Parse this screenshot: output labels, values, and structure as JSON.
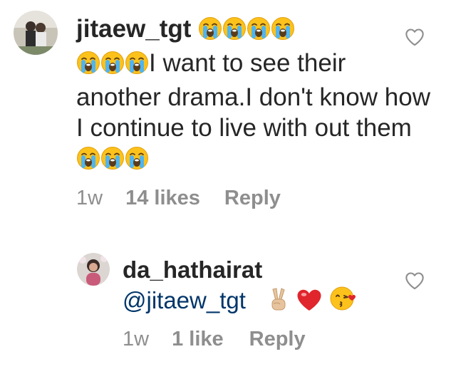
{
  "comments": [
    {
      "username": "jitaew_tgt",
      "username_emojis": [
        "crying-face",
        "crying-face",
        "crying-face",
        "crying-face"
      ],
      "lead_emojis": [
        "crying-face",
        "crying-face",
        "crying-face"
      ],
      "text": "I want to see their another drama.I don't know how I continue to live with out them",
      "trail_emojis": [
        "crying-face",
        "crying-face",
        "crying-face"
      ],
      "time": "1w",
      "likes": "14 likes",
      "reply_label": "Reply",
      "like_icon": "heart-outline-icon"
    },
    {
      "username": "da_hathairat",
      "mention": "@jitaew_tgt",
      "trail_emojis": [
        "victory-hand",
        "red-heart",
        "face-blowing-kiss"
      ],
      "time": "1w",
      "likes": "1 like",
      "reply_label": "Reply",
      "like_icon": "heart-outline-icon"
    }
  ],
  "colors": {
    "text": "#262626",
    "meta": "#8e8e8e",
    "mention": "#003569",
    "heart_icon": "#8e8e8e"
  }
}
